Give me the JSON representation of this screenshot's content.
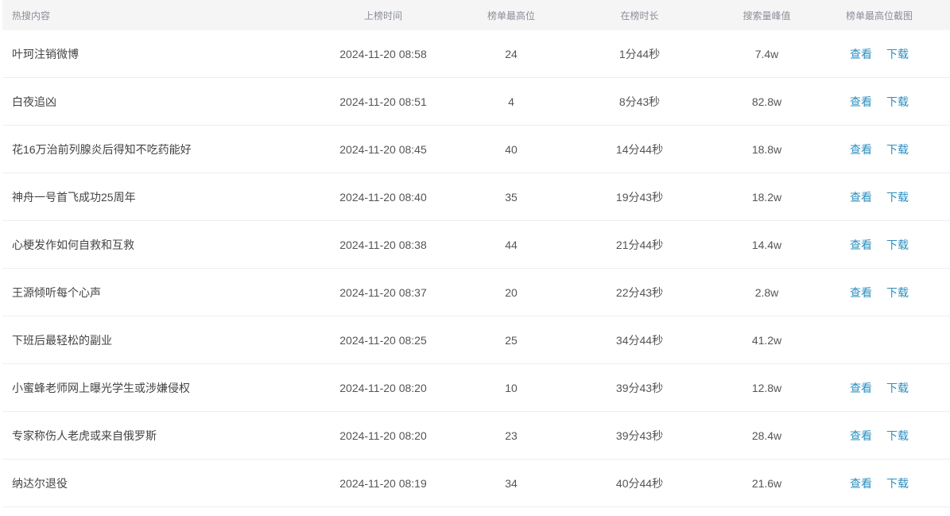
{
  "header": {
    "title": "热搜内容",
    "time": "上榜时间",
    "rank": "榜单最高位",
    "duration": "在榜时长",
    "peak": "搜索量峰值",
    "screenshot": "榜单最高位截图"
  },
  "rows": [
    {
      "title": "叶珂注销微博",
      "time": "2024-11-20 08:58",
      "rank": "24",
      "duration": "1分44秒",
      "peak": "7.4w",
      "view": "查看",
      "download": "下载"
    },
    {
      "title": "白夜追凶",
      "time": "2024-11-20 08:51",
      "rank": "4",
      "duration": "8分43秒",
      "peak": "82.8w",
      "view": "查看",
      "download": "下载"
    },
    {
      "title": "花16万治前列腺炎后得知不吃药能好",
      "time": "2024-11-20 08:45",
      "rank": "40",
      "duration": "14分44秒",
      "peak": "18.8w",
      "view": "查看",
      "download": "下载"
    },
    {
      "title": "神舟一号首飞成功25周年",
      "time": "2024-11-20 08:40",
      "rank": "35",
      "duration": "19分43秒",
      "peak": "18.2w",
      "view": "查看",
      "download": "下载"
    },
    {
      "title": "心梗发作如何自救和互救",
      "time": "2024-11-20 08:38",
      "rank": "44",
      "duration": "21分44秒",
      "peak": "14.4w",
      "view": "查看",
      "download": "下载"
    },
    {
      "title": "王源倾听每个心声",
      "time": "2024-11-20 08:37",
      "rank": "20",
      "duration": "22分43秒",
      "peak": "2.8w",
      "view": "查看",
      "download": "下载"
    },
    {
      "title": "下班后最轻松的副业",
      "time": "2024-11-20 08:25",
      "rank": "25",
      "duration": "34分44秒",
      "peak": "41.2w",
      "view": "",
      "download": ""
    },
    {
      "title": "小蜜蜂老师网上曝光学生或涉嫌侵权",
      "time": "2024-11-20 08:20",
      "rank": "10",
      "duration": "39分43秒",
      "peak": "12.8w",
      "view": "查看",
      "download": "下载"
    },
    {
      "title": "专家称伤人老虎或来自俄罗斯",
      "time": "2024-11-20 08:20",
      "rank": "23",
      "duration": "39分43秒",
      "peak": "28.4w",
      "view": "查看",
      "download": "下载"
    },
    {
      "title": "纳达尔退役",
      "time": "2024-11-20 08:19",
      "rank": "34",
      "duration": "40分44秒",
      "peak": "21.6w",
      "view": "查看",
      "download": "下载"
    }
  ],
  "colors": {
    "link": "#2b8fbf",
    "header_bg": "#f5f5f5",
    "border": "#ebeef5"
  }
}
